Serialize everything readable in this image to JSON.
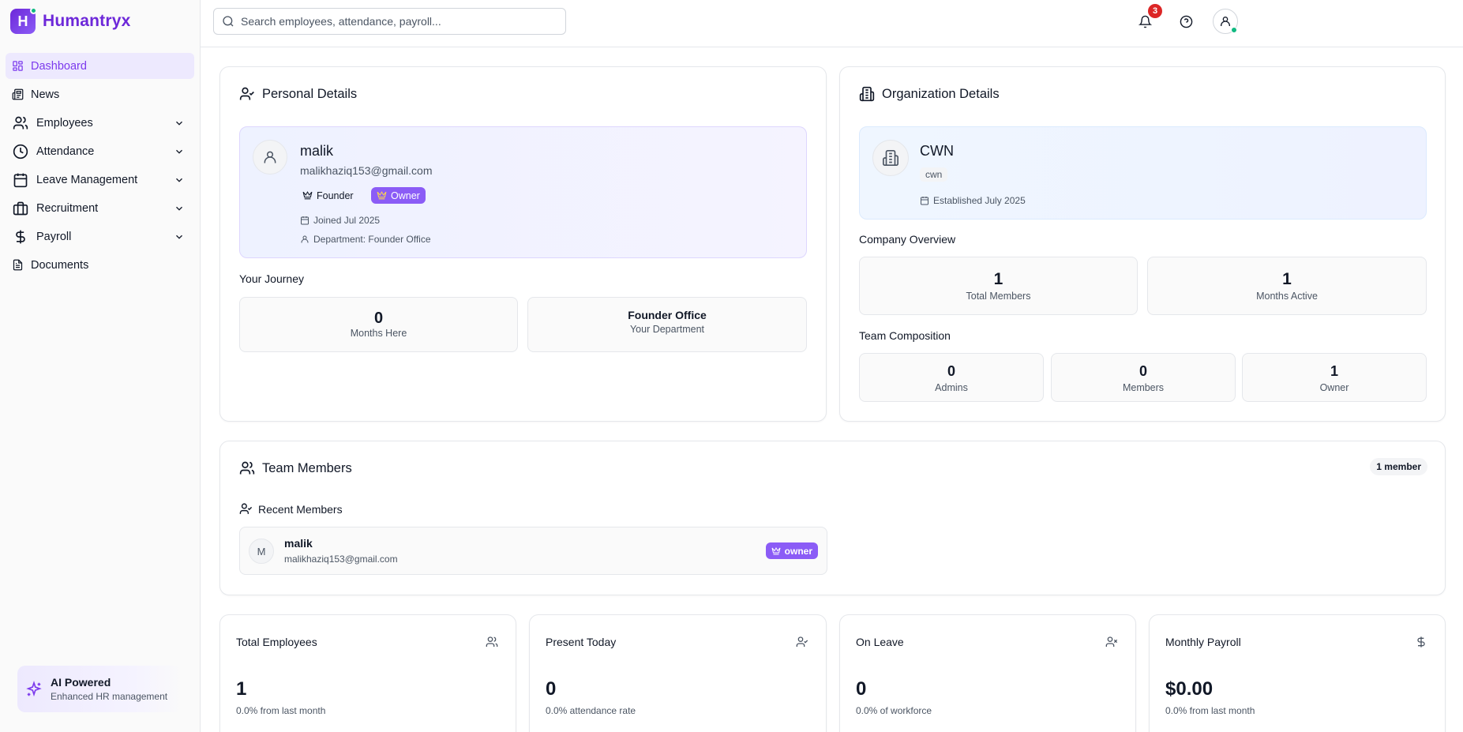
{
  "brand": {
    "letter": "H",
    "name": "Humantryx"
  },
  "sidebar": {
    "items": [
      {
        "label": "Dashboard",
        "icon": "dashboard-icon",
        "active": true,
        "expandable": false
      },
      {
        "label": "News",
        "icon": "newspaper-icon",
        "active": false,
        "expandable": false
      },
      {
        "label": "Employees",
        "icon": "users-icon",
        "active": false,
        "expandable": true
      },
      {
        "label": "Attendance",
        "icon": "clock-icon",
        "active": false,
        "expandable": true
      },
      {
        "label": "Leave Management",
        "icon": "calendar-icon",
        "active": false,
        "expandable": true
      },
      {
        "label": "Recruitment",
        "icon": "briefcase-icon",
        "active": false,
        "expandable": true
      },
      {
        "label": "Payroll",
        "icon": "dollar-icon",
        "active": false,
        "expandable": true
      },
      {
        "label": "Documents",
        "icon": "document-icon",
        "active": false,
        "expandable": false
      }
    ],
    "ai_card": {
      "title": "AI Powered",
      "subtitle": "Enhanced HR management"
    }
  },
  "header": {
    "search_placeholder": "Search employees, attendance, payroll...",
    "notification_count": "3"
  },
  "personal": {
    "title": "Personal Details",
    "name": "malik",
    "email": "malikhaziq153@gmail.com",
    "role_badge": "Founder",
    "owner_badge": "Owner",
    "joined": "Joined Jul 2025",
    "department": "Department: Founder Office",
    "journey_title": "Your Journey",
    "months_here_value": "0",
    "months_here_label": "Months Here",
    "department_value": "Founder Office",
    "department_label": "Your Department"
  },
  "organization": {
    "title": "Organization Details",
    "name": "CWN",
    "slug": "cwn",
    "established": "Established July 2025",
    "overview_title": "Company Overview",
    "total_members_value": "1",
    "total_members_label": "Total Members",
    "months_active_value": "1",
    "months_active_label": "Months Active",
    "composition_title": "Team Composition",
    "admins_value": "0",
    "admins_label": "Admins",
    "members_value": "0",
    "members_label": "Members",
    "owner_value": "1",
    "owner_label": "Owner"
  },
  "team": {
    "title": "Team Members",
    "count_badge": "1 member",
    "recent_title": "Recent Members",
    "members": [
      {
        "initial": "M",
        "name": "malik",
        "email": "malikhaziq153@gmail.com",
        "role": "owner"
      }
    ]
  },
  "metrics": [
    {
      "title": "Total Employees",
      "icon": "users-icon",
      "value": "1",
      "sub": "0.0% from last month"
    },
    {
      "title": "Present Today",
      "icon": "user-check-icon",
      "value": "0",
      "sub": "0.0% attendance rate"
    },
    {
      "title": "On Leave",
      "icon": "user-x-icon",
      "value": "0",
      "sub": "0.0% of workforce"
    },
    {
      "title": "Monthly Payroll",
      "icon": "dollar-icon",
      "value": "$0.00",
      "sub": "0.0% from last month"
    }
  ],
  "colors": {
    "accent": "#7c3aed",
    "badge_purple": "#8b5cf6",
    "notification": "#dc2626",
    "online": "#10b981"
  }
}
